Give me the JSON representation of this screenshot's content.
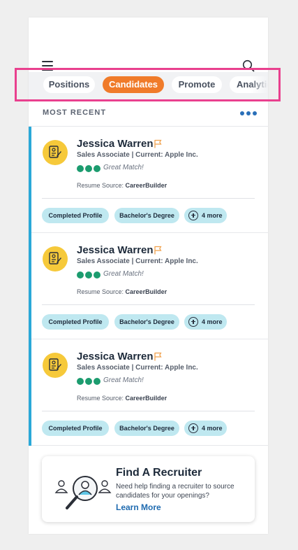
{
  "tabs": [
    {
      "label": "Positions",
      "active": false
    },
    {
      "label": "Candidates",
      "active": true
    },
    {
      "label": "Promote",
      "active": false
    },
    {
      "label": "Analytics",
      "active": false
    }
  ],
  "section": {
    "title": "MOST RECENT"
  },
  "candidates": [
    {
      "name": "Jessica Warren",
      "role": "Sales Associate | Current: Apple Inc.",
      "match": "Great Match!",
      "source_label": "Resume Source:",
      "source_value": "CareerBuilder",
      "tags": [
        "Completed Profile",
        "Bachelor's Degree"
      ],
      "more": "4 more"
    },
    {
      "name": "Jessica Warren",
      "role": "Sales Associate | Current: Apple Inc.",
      "match": "Great Match!",
      "source_label": "Resume Source:",
      "source_value": "CareerBuilder",
      "tags": [
        "Completed Profile",
        "Bachelor's Degree"
      ],
      "more": "4 more"
    },
    {
      "name": "Jessica Warren",
      "role": "Sales Associate | Current: Apple Inc.",
      "match": "Great Match!",
      "source_label": "Resume Source:",
      "source_value": "CareerBuilder",
      "tags": [
        "Completed Profile",
        "Bachelor's Degree"
      ],
      "more": "4 more"
    }
  ],
  "promo": {
    "title": "Find A Recruiter",
    "text": "Need help finding a recruiter to source candidates for your openings?",
    "link": "Learn More"
  },
  "colors": {
    "accent_orange": "#f07b2a",
    "card_accent": "#2aa8d8",
    "match_green": "#1c9c6f",
    "chip_bg": "#bfe8f0",
    "link_blue": "#1f6bb0",
    "highlight_pink": "#e9408e"
  },
  "icons": [
    "menu-icon",
    "search-icon",
    "more-dots-icon",
    "resume-icon",
    "flag-icon",
    "plus-circle-icon",
    "recruiter-search-illustration"
  ]
}
